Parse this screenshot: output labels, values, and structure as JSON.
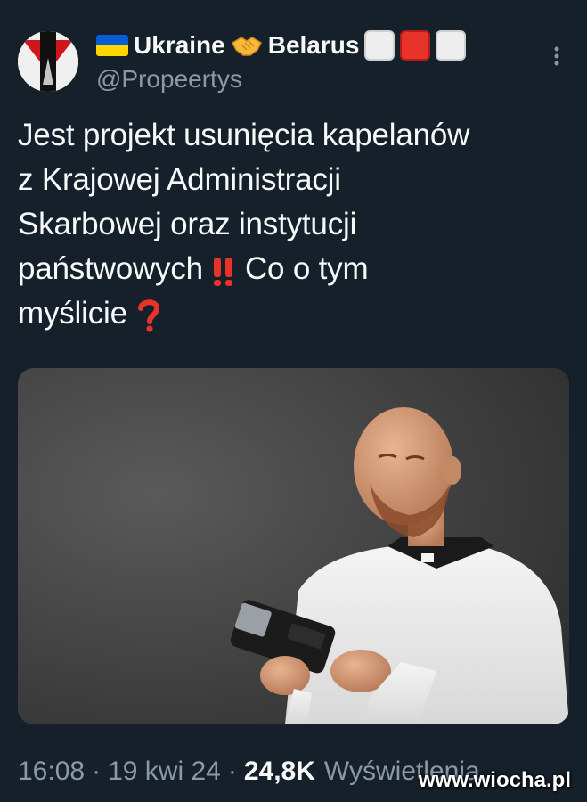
{
  "author": {
    "display_name_1": "Ukraine",
    "display_name_2": "Belarus",
    "handle": "@Propeertys"
  },
  "icons": {
    "avatar": "avatar-icon",
    "flag": "ukraine-flag-icon",
    "handshake": "handshake-icon",
    "squares": [
      "white-square-icon",
      "red-square-icon",
      "white-square-icon"
    ],
    "more": "more-vertical-icon",
    "exclamation": "double-exclamation-icon",
    "question": "red-question-mark-icon"
  },
  "tweet": {
    "line1": "Jest projekt usunięcia kapelanów",
    "line2": "z Krajowej Administracji",
    "line3": "Skarbowej oraz instytucji",
    "line4": "państwowych",
    "line4_after": "Co o tym",
    "line5": "myślicie"
  },
  "meta": {
    "time": "16:08",
    "date": "19 kwi 24",
    "views_count": "24,8K",
    "views_label": "Wyświetlenia"
  },
  "watermark": "www.wiocha.pl",
  "colors": {
    "background": "#15202b",
    "text": "#f7f9f9",
    "secondary": "#8b98a5",
    "accent_red": "#e8332b"
  }
}
